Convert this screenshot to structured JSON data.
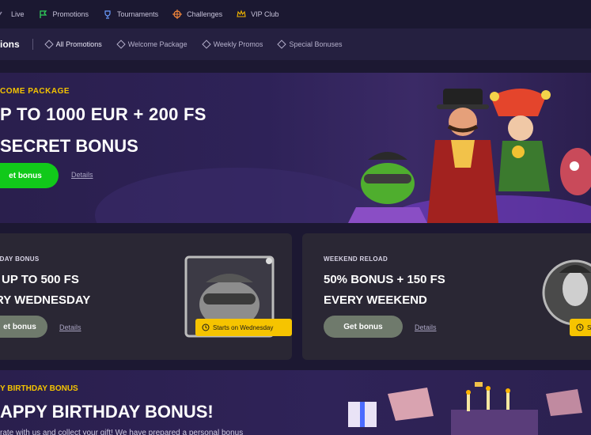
{
  "topnav": {
    "items": [
      {
        "label": "Live",
        "icon": "live-icon"
      },
      {
        "label": "Promotions",
        "icon": "flag-icon"
      },
      {
        "label": "Tournaments",
        "icon": "trophy-icon"
      },
      {
        "label": "Challenges",
        "icon": "target-icon"
      },
      {
        "label": "VIP Club",
        "icon": "crown-icon"
      }
    ]
  },
  "subnav": {
    "title": "ions",
    "tabs": [
      {
        "label": "All Promotions"
      },
      {
        "label": "Welcome Package"
      },
      {
        "label": "Weekly Promos"
      },
      {
        "label": "Special Bonuses"
      }
    ]
  },
  "welcome": {
    "eyebrow": "COME PACKAGE",
    "line1": "P TO 1000 EUR + 200 FS",
    "line2": "SECRET BONUS",
    "cta": "et bonus",
    "details": "Details"
  },
  "cards": [
    {
      "eyebrow": "SDAY BONUS",
      "line1": "UP TO 500 FS",
      "line2": "RY WEDNESDAY",
      "cta": "et bonus",
      "details": "Details",
      "pill": "Starts on Wednesday"
    },
    {
      "eyebrow": "WEEKEND RELOAD",
      "line1": "50% BONUS + 150 FS",
      "line2": "EVERY WEEKEND",
      "cta": "Get bonus",
      "details": "Details",
      "pill": "S"
    }
  ],
  "birthday": {
    "eyebrow": "Y BIRTHDAY BONUS",
    "title": "APPY BIRTHDAY BONUS!",
    "desc": "rate with us and collect your gift! We have prepared a personal bonus"
  },
  "colors": {
    "accent_yellow": "#f5c400",
    "cta_green": "#11c91a",
    "cta_grey": "#6f7a6c",
    "bg_dark": "#1c1832"
  }
}
